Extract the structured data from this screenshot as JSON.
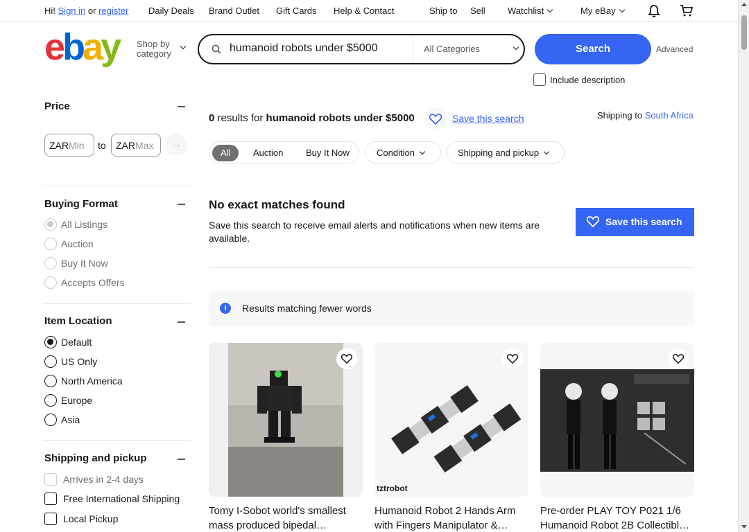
{
  "topbar": {
    "greeting": "Hi!",
    "sign_in": "Sign in",
    "or": "or",
    "register": "register",
    "daily_deals": "Daily Deals",
    "brand_outlet": "Brand Outlet",
    "gift_cards": "Gift Cards",
    "help_contact": "Help & Contact",
    "ship_to": "Ship to",
    "sell": "Sell",
    "watchlist": "Watchlist",
    "my_ebay": "My eBay"
  },
  "header": {
    "logo": {
      "e": "e",
      "b": "b",
      "a": "a",
      "y": "y"
    },
    "shop_by_line1": "Shop by",
    "shop_by_line2": "category",
    "search_value": "humanoid robots under $5000",
    "category": "All Categories",
    "search_button": "Search",
    "advanced": "Advanced",
    "include_description": "Include description"
  },
  "sidebar": {
    "price": {
      "title": "Price",
      "currency_min": "ZAR",
      "min_placeholder": "Min",
      "to": "to",
      "currency_max": "ZAR",
      "max_placeholder": "Max"
    },
    "buying_format": {
      "title": "Buying Format",
      "options": [
        "All Listings",
        "Auction",
        "Buy It Now",
        "Accepts Offers"
      ],
      "selected": "All Listings"
    },
    "item_location": {
      "title": "Item Location",
      "options": [
        "Default",
        "US Only",
        "North America",
        "Europe",
        "Asia"
      ],
      "selected": "Default"
    },
    "shipping": {
      "title": "Shipping and pickup",
      "options": [
        "Arrives in 2-4 days",
        "Free International Shipping",
        "Local Pickup"
      ]
    }
  },
  "main": {
    "results_count": "0",
    "results_for": "results for",
    "query": "humanoid robots under $5000",
    "save_search_link": "Save this search",
    "shipping_to_label": "Shipping to",
    "shipping_country": "South Africa",
    "format_pills": [
      "All",
      "Auction",
      "Buy It Now"
    ],
    "condition_pill": "Condition",
    "shipping_pill": "Shipping and pickup",
    "no_match_title": "No exact matches found",
    "no_match_text": "Save this search to receive email alerts and notifications when new items are available.",
    "save_search_button": "Save this search",
    "fewer_words_banner": "Results matching fewer words",
    "info_glyph": "i"
  },
  "cards": [
    {
      "title": "Tomy I-Sobot world's smallest mass produced bipedal…",
      "image": "small black bipedal robot with green light"
    },
    {
      "title": "Humanoid Robot 2 Hands Arm with Fingers Manipulator &…",
      "image": "robotic arm hands with servos",
      "watermark": "tztrobot"
    },
    {
      "title": "Pre-order PLAY TOY P021 1/6 Humanoid Robot 2B Collectibl…",
      "image": "1/6 scale figure collectible set"
    }
  ],
  "icons": {
    "search": "search-icon",
    "heart": "heart-icon",
    "bell": "bell-icon",
    "cart": "cart-icon",
    "arrow": "arrow-right-icon",
    "info": "info-icon"
  },
  "colors": {
    "primary": "#3665f3",
    "text": "#191919",
    "muted": "#707070"
  }
}
